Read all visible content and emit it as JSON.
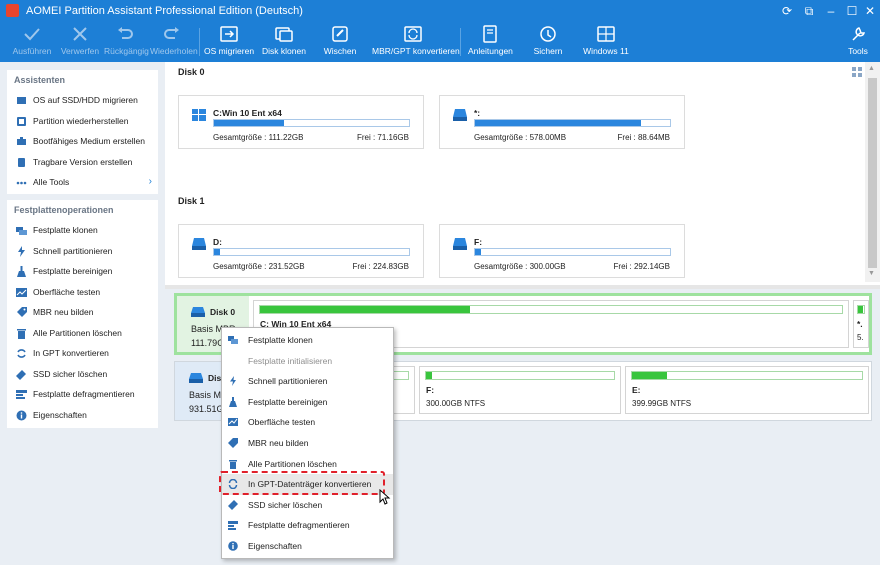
{
  "window": {
    "title": "AOMEI Partition Assistant Professional Edition (Deutsch)"
  },
  "toolbar": {
    "items": [
      {
        "label": "Ausführen",
        "icon": "check-icon",
        "enabled": false
      },
      {
        "label": "Verwerfen",
        "icon": "cross-icon",
        "enabled": false
      },
      {
        "label": "Rückgängig",
        "icon": "undo-icon",
        "enabled": false
      },
      {
        "label": "Wiederholen",
        "icon": "redo-icon",
        "enabled": false
      },
      {
        "label": "OS migrieren",
        "icon": "migrate-icon",
        "enabled": true
      },
      {
        "label": "Disk klonen",
        "icon": "disk-clone-icon",
        "enabled": true
      },
      {
        "label": "Wischen",
        "icon": "wipe-icon",
        "enabled": true
      },
      {
        "label": "MBR/GPT konvertieren",
        "icon": "convert-icon",
        "enabled": true
      },
      {
        "label": "Anleitungen",
        "icon": "book-icon",
        "enabled": true
      },
      {
        "label": "Sichern",
        "icon": "backup-icon",
        "enabled": true
      },
      {
        "label": "Windows 11",
        "icon": "windows-icon",
        "enabled": true
      },
      {
        "label": "Tools",
        "icon": "tools-icon",
        "enabled": true
      }
    ]
  },
  "sidebar": {
    "assistants": {
      "heading": "Assistenten",
      "items": [
        {
          "label": "OS auf SSD/HDD migrieren",
          "icon": "migrate-icon"
        },
        {
          "label": "Partition wiederherstellen",
          "icon": "recover-icon"
        },
        {
          "label": "Bootfähiges Medium erstellen",
          "icon": "bootable-icon"
        },
        {
          "label": "Tragbare Version erstellen",
          "icon": "portable-icon"
        },
        {
          "label": "Alle Tools",
          "icon": "more-icon",
          "chevron": "›"
        }
      ]
    },
    "disk_ops": {
      "heading": "Festplattenoperationen",
      "items": [
        {
          "label": "Festplatte klonen",
          "icon": "disk-clone-icon"
        },
        {
          "label": "Schnell partitionieren",
          "icon": "lightning-icon"
        },
        {
          "label": "Festplatte bereinigen",
          "icon": "broom-icon"
        },
        {
          "label": "Oberfläche testen",
          "icon": "surface-test-icon"
        },
        {
          "label": "MBR neu bilden",
          "icon": "tag-icon"
        },
        {
          "label": "Alle Partitionen löschen",
          "icon": "trash-icon"
        },
        {
          "label": "In GPT konvertieren",
          "icon": "convert-icon"
        },
        {
          "label": "SSD sicher löschen",
          "icon": "eraser-icon"
        },
        {
          "label": "Festplatte defragmentieren",
          "icon": "defrag-icon"
        },
        {
          "label": "Eigenschaften",
          "icon": "info-icon"
        }
      ]
    }
  },
  "disks_top": [
    {
      "title": "Disk 0",
      "partitions": [
        {
          "name": "C:Win 10 Ent x64",
          "total": "Gesamtgröße : 111.22GB",
          "free": "Frei : 71.16GB",
          "used_fraction": 0.36,
          "icon": "windows-icon"
        },
        {
          "name": "*:",
          "total": "Gesamtgröße : 578.00MB",
          "free": "Frei : 88.64MB",
          "used_fraction": 0.85,
          "icon": "drive-icon"
        }
      ]
    },
    {
      "title": "Disk 1",
      "partitions": [
        {
          "name": "D:",
          "total": "Gesamtgröße : 231.52GB",
          "free": "Frei : 224.83GB",
          "used_fraction": 0.03,
          "icon": "drive-icon"
        },
        {
          "name": "F:",
          "total": "Gesamtgröße : 300.00GB",
          "free": "Frei : 292.14GB",
          "used_fraction": 0.03,
          "icon": "drive-icon"
        }
      ]
    }
  ],
  "disk_rows": [
    {
      "name": "Disk 0",
      "type": "Basis MBR",
      "size": "111.79G",
      "segments": [
        {
          "label": "C: Win 10 Ent x64",
          "info": "",
          "used_fraction": 0.36
        },
        {
          "label": "*.",
          "info": "5.",
          "used_fraction": 0.85
        }
      ]
    },
    {
      "name": "Dis",
      "type": "Basis M",
      "size": "931.51G",
      "segments": [
        {
          "label": "",
          "info": "",
          "used_fraction": 0.03
        },
        {
          "label": "F:",
          "info": "300.00GB NTFS",
          "used_fraction": 0.03
        },
        {
          "label": "E:",
          "info": "399.99GB NTFS",
          "used_fraction": 0.15
        }
      ]
    }
  ],
  "context_menu": {
    "items": [
      {
        "label": "Festplatte klonen",
        "icon": "disk-clone-icon",
        "enabled": true
      },
      {
        "label": "Festplatte initialisieren",
        "icon": "",
        "enabled": false
      },
      {
        "label": "Schnell partitionieren",
        "icon": "lightning-icon",
        "enabled": true
      },
      {
        "label": "Festplatte bereinigen",
        "icon": "broom-icon",
        "enabled": true
      },
      {
        "label": "Oberfläche testen",
        "icon": "surface-test-icon",
        "enabled": true
      },
      {
        "label": "MBR neu bilden",
        "icon": "tag-icon",
        "enabled": true
      },
      {
        "label": "Alle Partitionen löschen",
        "icon": "trash-icon",
        "enabled": true
      },
      {
        "label": "In GPT-Datenträger konvertieren",
        "icon": "convert-icon",
        "enabled": true,
        "highlighted": true
      },
      {
        "label": "SSD sicher löschen",
        "icon": "eraser-icon",
        "enabled": true
      },
      {
        "label": "Festplatte defragmentieren",
        "icon": "defrag-icon",
        "enabled": true
      },
      {
        "label": "Eigenschaften",
        "icon": "info-icon",
        "enabled": true
      }
    ]
  },
  "colors": {
    "titlebar": "#1d7fd6",
    "partition_bar": "#2b86de",
    "segment_bar": "#39c53d",
    "selected_disk_border": "#9ee29e",
    "highlight_dash": "#e0202a"
  }
}
